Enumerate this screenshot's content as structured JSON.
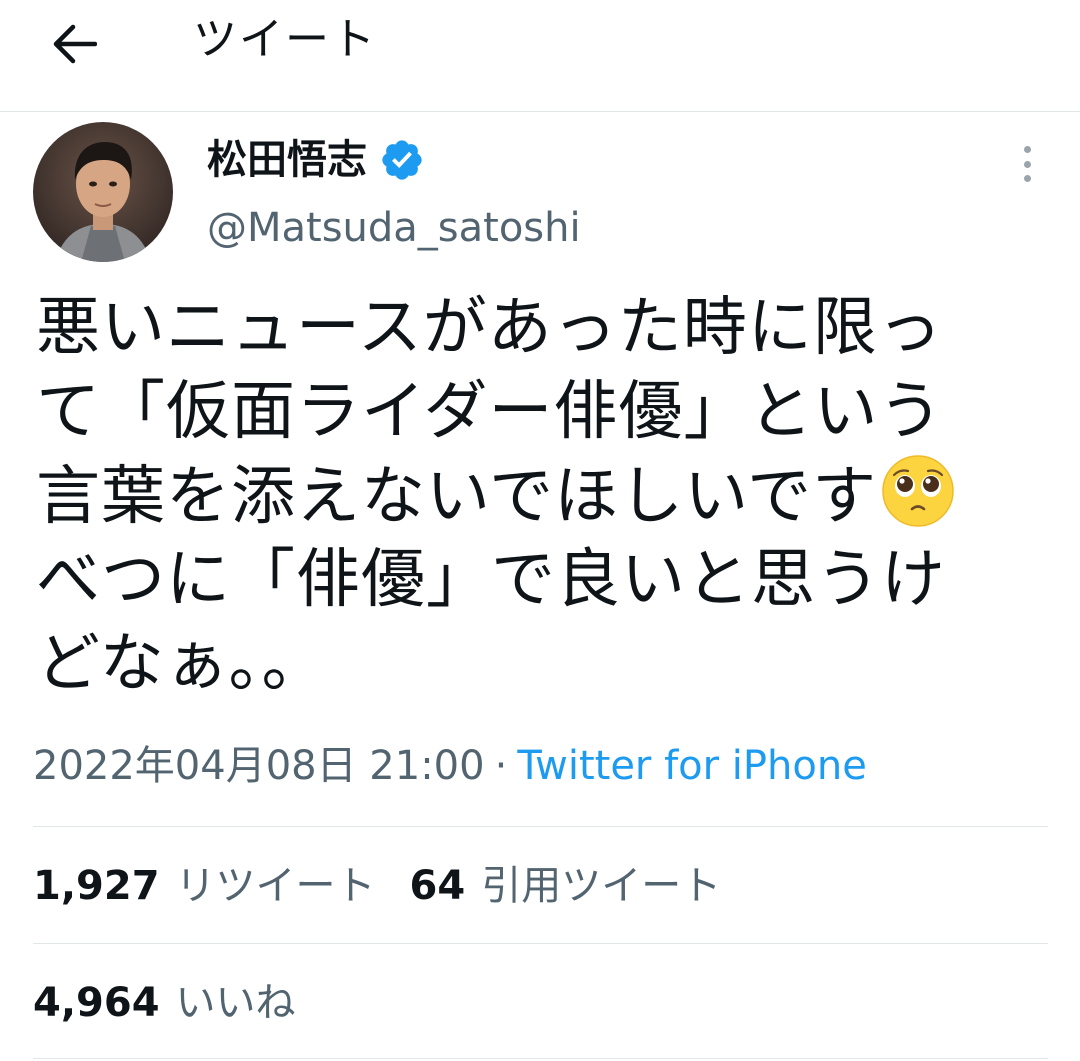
{
  "header": {
    "title": "ツイート",
    "back_icon": "arrow-left-icon"
  },
  "author": {
    "display_name": "松田悟志",
    "handle": "@Matsuda_satoshi",
    "verified": true,
    "verified_color": "#1d9bf0"
  },
  "tweet": {
    "lines": [
      "悪いニュースがあった時に限っ",
      "て「仮面ライダー俳優」という",
      "言葉を添えないでほしいです",
      "べつに「俳優」で良いと思うけ",
      "どなぁ。。"
    ],
    "emoji": "pleading-face-emoji"
  },
  "meta": {
    "timestamp": "2022年04月08日 21:00",
    "separator": "·",
    "source": "Twitter for iPhone"
  },
  "stats": {
    "retweets_count": "1,927",
    "retweets_label": "リツイート",
    "quotes_count": "64",
    "quotes_label": "引用ツイート",
    "likes_count": "4,964",
    "likes_label": "いいね"
  },
  "colors": {
    "link": "#1d9bf0",
    "secondary_text": "#536471",
    "divider": "#e3e6e8"
  }
}
